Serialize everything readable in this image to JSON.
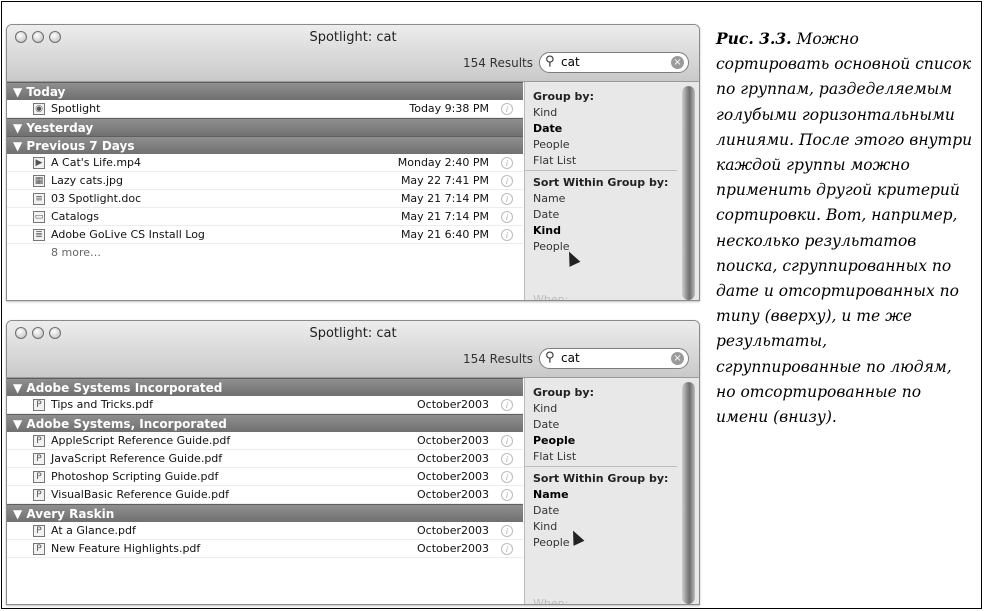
{
  "window1": {
    "title": "Spotlight: cat",
    "results": "154 Results",
    "search_value": "cat",
    "groups": [
      {
        "label": "▼ Today",
        "rows": [
          {
            "icon": "spotlight-icon",
            "name": "Spotlight",
            "date": "Today 9:38 PM"
          }
        ]
      },
      {
        "label": "▼ Yesterday",
        "rows": []
      },
      {
        "label": "▼ Previous 7 Days",
        "rows": [
          {
            "icon": "movie-icon",
            "name": "A Cat's Life.mp4",
            "date": "Monday 2:40 PM"
          },
          {
            "icon": "image-icon",
            "name": "Lazy cats.jpg",
            "date": "May 22 7:41 PM"
          },
          {
            "icon": "document-icon",
            "name": "03 Spotlight.doc",
            "date": "May 21 7:14 PM"
          },
          {
            "icon": "folder-icon",
            "name": "Catalogs",
            "date": "May 21 7:14 PM"
          },
          {
            "icon": "log-icon",
            "name": "Adobe GoLive CS Install Log",
            "date": "May 21 6:40 PM"
          }
        ]
      }
    ],
    "more": "8 more…",
    "group_by": {
      "heading": "Group by:",
      "items": [
        "Kind",
        "Date",
        "People",
        "Flat List"
      ],
      "selected": "Date"
    },
    "sort_by": {
      "heading": "Sort Within Group by:",
      "items": [
        "Name",
        "Date",
        "Kind",
        "People"
      ],
      "selected": "Kind"
    },
    "when": "When:"
  },
  "window2": {
    "title": "Spotlight: cat",
    "results": "154 Results",
    "search_value": "cat",
    "groups": [
      {
        "label": "▼ Adobe Systems Incorporated",
        "rows": [
          {
            "icon": "pdf-icon",
            "name": "Tips and Tricks.pdf",
            "date": "October2003"
          }
        ]
      },
      {
        "label": "▼ Adobe Systems, Incorporated",
        "rows": [
          {
            "icon": "pdf-icon",
            "name": "AppleScript Reference Guide.pdf",
            "date": "October2003"
          },
          {
            "icon": "pdf-icon",
            "name": "JavaScript Reference Guide.pdf",
            "date": "October2003"
          },
          {
            "icon": "pdf-icon",
            "name": "Photoshop Scripting Guide.pdf",
            "date": "October2003"
          },
          {
            "icon": "pdf-icon",
            "name": "VisualBasic Reference Guide.pdf",
            "date": "October2003"
          }
        ]
      },
      {
        "label": "▼ Avery Raskin",
        "rows": [
          {
            "icon": "pdf-icon",
            "name": "At a Glance.pdf",
            "date": "October2003"
          },
          {
            "icon": "pdf-icon",
            "name": "New Feature Highlights.pdf",
            "date": "October2003"
          }
        ]
      }
    ],
    "group_by": {
      "heading": "Group by:",
      "items": [
        "Kind",
        "Date",
        "People",
        "Flat List"
      ],
      "selected": "People"
    },
    "sort_by": {
      "heading": "Sort Within Group by:",
      "items": [
        "Name",
        "Date",
        "Kind",
        "People"
      ],
      "selected": "Name"
    },
    "when": "When:"
  },
  "caption": {
    "label": "Рис. 3.3.",
    "text": "Можно сортировать основной список по группам, раздеделяемым голубыми горизонтальными линиями. После этого внутри каждой группы можно применить другой критерий сортировки. Вот, например, несколько результатов поиска, сгруппированных по дате и отсортированных по типу (вверху), и те же результаты, сгруппированные по людям, но отсортированные по имени (внизу)."
  }
}
